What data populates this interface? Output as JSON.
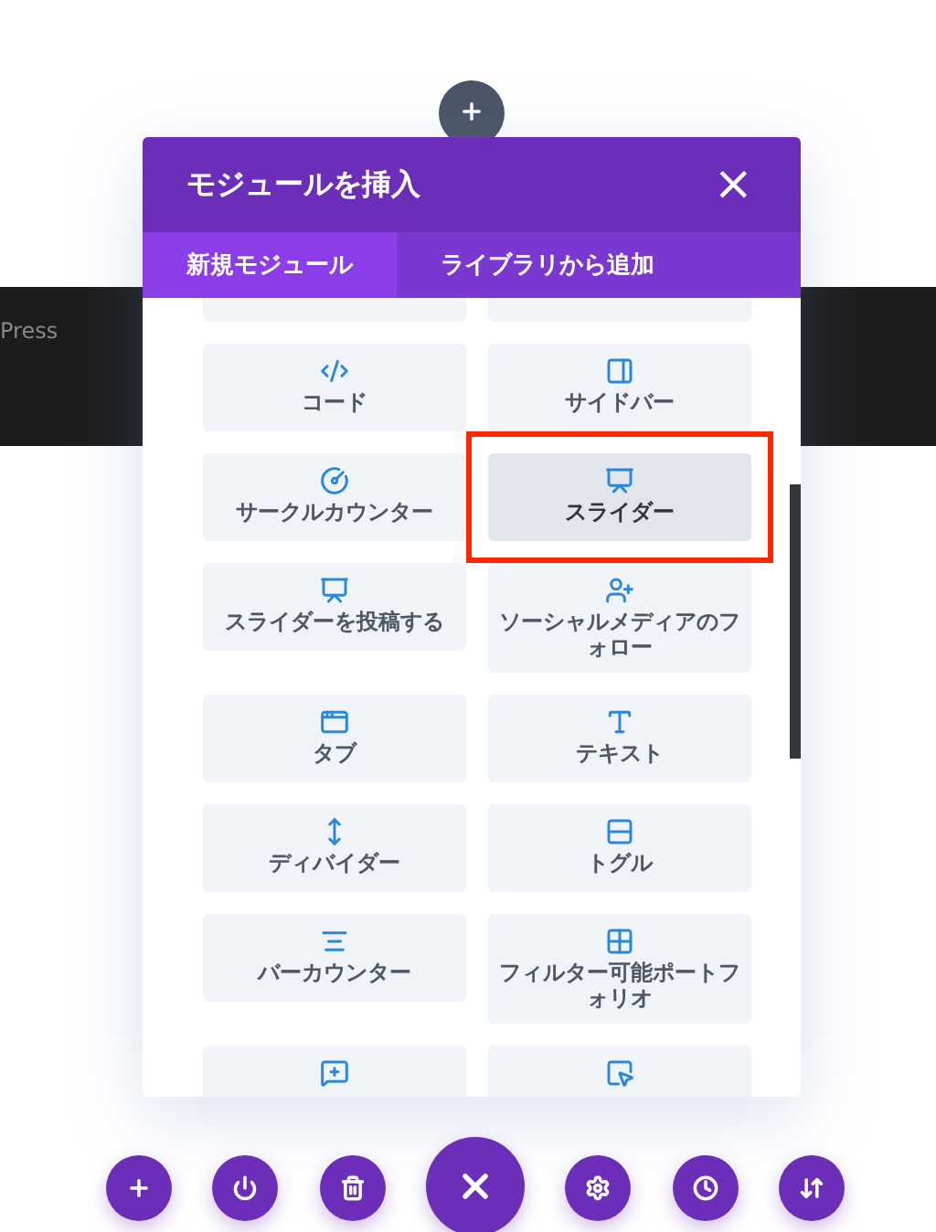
{
  "background": {
    "text": "Press"
  },
  "dialog": {
    "title": "モジュールを挿入",
    "close": "×",
    "tabs": [
      {
        "label": "新規モジュール",
        "selected": true
      },
      {
        "label": "ライブラリから追加",
        "selected": false
      }
    ],
    "modules": [
      {
        "kind": "cut_top",
        "selected": false
      },
      {
        "kind": "cut_top",
        "selected": false
      },
      {
        "kind": "full",
        "label": "コード",
        "selected": false
      },
      {
        "kind": "full",
        "label": "サイドバー",
        "selected": false
      },
      {
        "kind": "full",
        "label": "サークルカウンター",
        "selected": false
      },
      {
        "kind": "full",
        "label": "スライダー",
        "selected": true
      },
      {
        "kind": "full",
        "label": "スライダーを投稿する",
        "selected": false
      },
      {
        "kind": "full",
        "label": "ソーシャルメディアのフォロー",
        "selected": false
      },
      {
        "kind": "full",
        "label": "タブ",
        "selected": false
      },
      {
        "kind": "full",
        "label": "テキスト",
        "selected": false
      },
      {
        "kind": "full",
        "label": "ディバイダー",
        "selected": false
      },
      {
        "kind": "full",
        "label": "トグル",
        "selected": false
      },
      {
        "kind": "full",
        "label": "バーカウンター",
        "selected": false
      },
      {
        "kind": "full",
        "label": "フィルター可能ポートフォリオ",
        "selected": false
      },
      {
        "kind": "cut_bottom",
        "selected": false
      },
      {
        "kind": "cut_bottom",
        "selected": false
      }
    ]
  }
}
